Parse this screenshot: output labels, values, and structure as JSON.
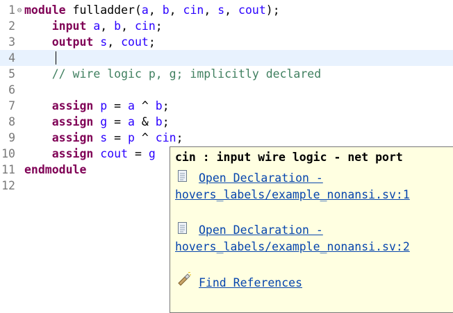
{
  "editor": {
    "lines": [
      {
        "num": "1",
        "fold": "⊖",
        "tokens": [
          {
            "t": "module",
            "c": "kw"
          },
          {
            "t": " fulladder(",
            "c": ""
          },
          {
            "t": "a",
            "c": "id"
          },
          {
            "t": ", ",
            "c": ""
          },
          {
            "t": "b",
            "c": "id"
          },
          {
            "t": ", ",
            "c": ""
          },
          {
            "t": "cin",
            "c": "id"
          },
          {
            "t": ", ",
            "c": ""
          },
          {
            "t": "s",
            "c": "id"
          },
          {
            "t": ", ",
            "c": ""
          },
          {
            "t": "cout",
            "c": "id"
          },
          {
            "t": ");",
            "c": ""
          }
        ]
      },
      {
        "num": "2",
        "fold": "",
        "tokens": [
          {
            "t": "    ",
            "c": ""
          },
          {
            "t": "input",
            "c": "kw"
          },
          {
            "t": " ",
            "c": ""
          },
          {
            "t": "a",
            "c": "id"
          },
          {
            "t": ", ",
            "c": ""
          },
          {
            "t": "b",
            "c": "id"
          },
          {
            "t": ", ",
            "c": ""
          },
          {
            "t": "cin",
            "c": "id"
          },
          {
            "t": ";",
            "c": ""
          }
        ]
      },
      {
        "num": "3",
        "fold": "",
        "tokens": [
          {
            "t": "    ",
            "c": ""
          },
          {
            "t": "output",
            "c": "kw"
          },
          {
            "t": " ",
            "c": ""
          },
          {
            "t": "s",
            "c": "id"
          },
          {
            "t": ", ",
            "c": ""
          },
          {
            "t": "cout",
            "c": "id"
          },
          {
            "t": ";",
            "c": ""
          }
        ]
      },
      {
        "num": "4",
        "fold": "",
        "current": true,
        "tokens": []
      },
      {
        "num": "5",
        "fold": "",
        "tokens": [
          {
            "t": "    ",
            "c": ""
          },
          {
            "t": "// wire logic p, g; implicitly declared",
            "c": "cmt"
          }
        ]
      },
      {
        "num": "6",
        "fold": "",
        "tokens": []
      },
      {
        "num": "7",
        "fold": "",
        "tokens": [
          {
            "t": "    ",
            "c": ""
          },
          {
            "t": "assign",
            "c": "kw"
          },
          {
            "t": " ",
            "c": ""
          },
          {
            "t": "p",
            "c": "id"
          },
          {
            "t": " = ",
            "c": ""
          },
          {
            "t": "a",
            "c": "id"
          },
          {
            "t": " ^ ",
            "c": ""
          },
          {
            "t": "b",
            "c": "id"
          },
          {
            "t": ";",
            "c": ""
          }
        ]
      },
      {
        "num": "8",
        "fold": "",
        "tokens": [
          {
            "t": "    ",
            "c": ""
          },
          {
            "t": "assign",
            "c": "kw"
          },
          {
            "t": " ",
            "c": ""
          },
          {
            "t": "g",
            "c": "id"
          },
          {
            "t": " = ",
            "c": ""
          },
          {
            "t": "a",
            "c": "id"
          },
          {
            "t": " & ",
            "c": ""
          },
          {
            "t": "b",
            "c": "id"
          },
          {
            "t": ";",
            "c": ""
          }
        ]
      },
      {
        "num": "9",
        "fold": "",
        "tokens": [
          {
            "t": "    ",
            "c": ""
          },
          {
            "t": "assign",
            "c": "kw"
          },
          {
            "t": " ",
            "c": ""
          },
          {
            "t": "s",
            "c": "id"
          },
          {
            "t": " = ",
            "c": ""
          },
          {
            "t": "p",
            "c": "id"
          },
          {
            "t": " ^ ",
            "c": ""
          },
          {
            "t": "cin",
            "c": "id"
          },
          {
            "t": ";",
            "c": ""
          }
        ]
      },
      {
        "num": "10",
        "fold": "",
        "tokens": [
          {
            "t": "    ",
            "c": ""
          },
          {
            "t": "assign",
            "c": "kw"
          },
          {
            "t": " ",
            "c": ""
          },
          {
            "t": "cout",
            "c": "id"
          },
          {
            "t": " = ",
            "c": ""
          },
          {
            "t": "g",
            "c": "id"
          }
        ]
      },
      {
        "num": "11",
        "fold": "",
        "tokens": [
          {
            "t": "endmodule",
            "c": "kw"
          }
        ]
      },
      {
        "num": "12",
        "fold": "",
        "tokens": []
      }
    ]
  },
  "hover": {
    "title": "cin : input wire logic - net port",
    "decl1_line1": "Open Declaration -",
    "decl1_line2": "hovers_labels/example_nonansi.sv:1",
    "decl2_line1": "Open Declaration -",
    "decl2_line2": "hovers_labels/example_nonansi.sv:2",
    "find_refs": "Find References",
    "icons": {
      "declaration": "document-icon",
      "references": "flashlight-icon"
    }
  }
}
